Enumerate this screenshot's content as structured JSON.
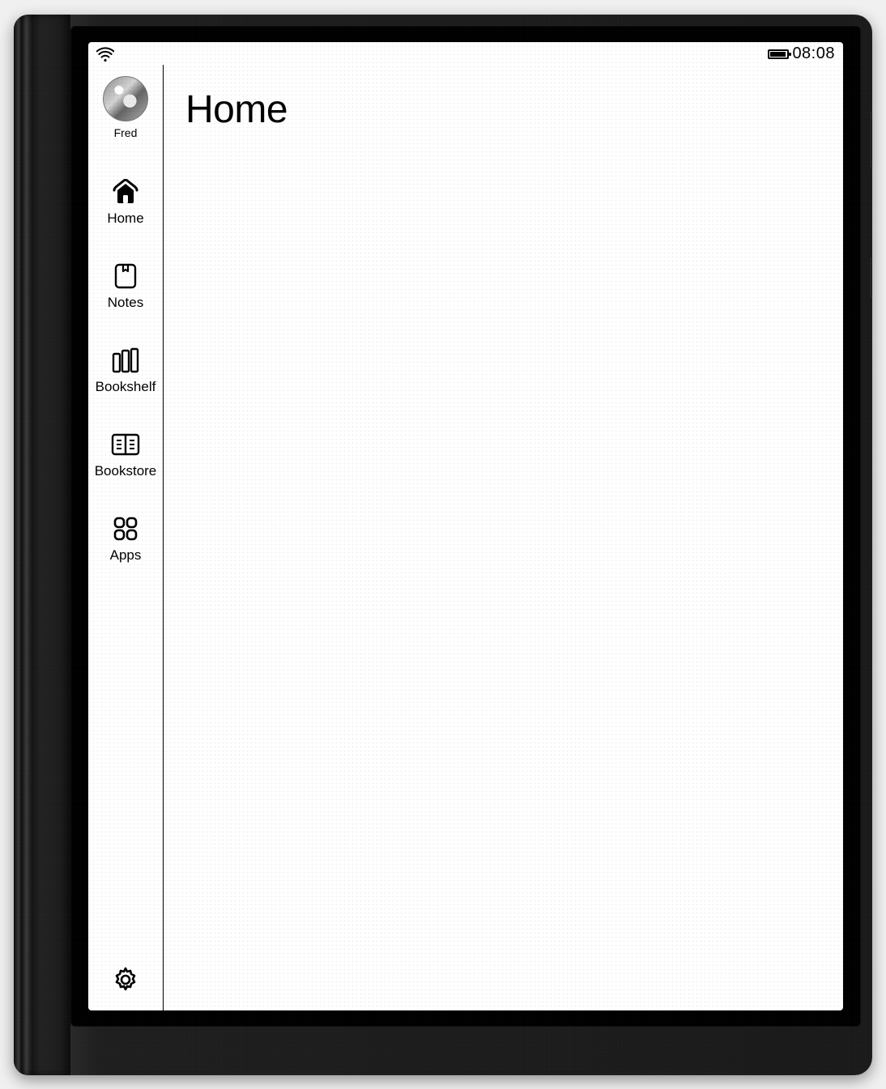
{
  "statusbar": {
    "wifi_connected": true,
    "battery_percent": 85,
    "clock": "08:08"
  },
  "user": {
    "name": "Fred"
  },
  "sidebar": {
    "items": [
      {
        "label": "Home",
        "icon": "home-icon",
        "active": true
      },
      {
        "label": "Notes",
        "icon": "notes-icon",
        "active": false
      },
      {
        "label": "Bookshelf",
        "icon": "bookshelf-icon",
        "active": false
      },
      {
        "label": "Bookstore",
        "icon": "bookstore-icon",
        "active": false
      },
      {
        "label": "Apps",
        "icon": "apps-icon",
        "active": false
      }
    ],
    "settings_label": "Settings"
  },
  "main": {
    "title": "Home"
  }
}
